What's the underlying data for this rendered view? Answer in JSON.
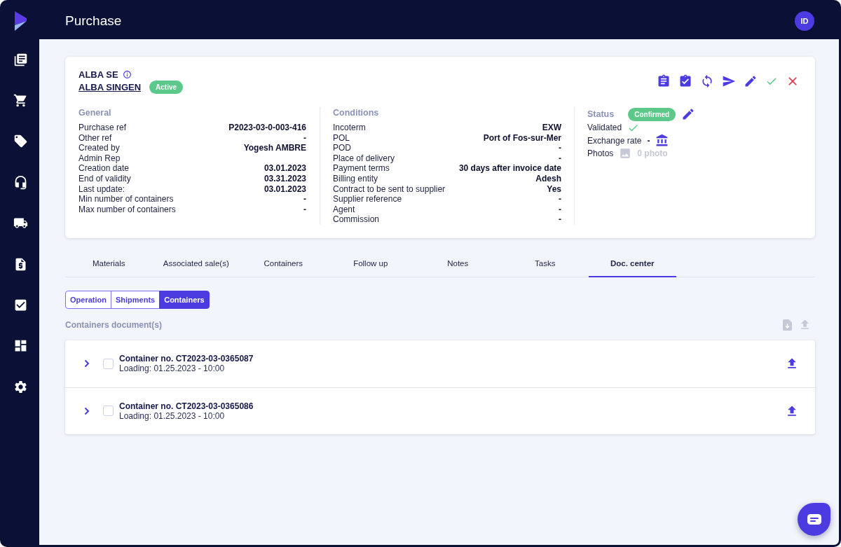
{
  "header": {
    "title": "Purchase",
    "avatar_initials": "ID"
  },
  "supplier": {
    "name": "ALBA SE",
    "site": "ALBA SINGEN",
    "badge": "Active"
  },
  "sections": [
    {
      "title": "General",
      "rows": [
        {
          "label": "Purchase ref",
          "value": "P2023-03-0-003-416"
        },
        {
          "label": "Other ref",
          "value": "-"
        },
        {
          "label": "Created by",
          "value": "Yogesh AMBRE"
        },
        {
          "label": "Admin Rep"
        },
        {
          "label": "Creation date",
          "value": "03.01.2023"
        },
        {
          "label": "End of validity",
          "value": "03.31.2023"
        },
        {
          "label": "Last update:",
          "value": "03.01.2023"
        },
        {
          "label": "Min number of containers",
          "value": "-"
        },
        {
          "label": "Max number of containers",
          "value": "-"
        }
      ]
    },
    {
      "title": "Conditions",
      "rows": [
        {
          "label": "Incoterm",
          "value": "EXW"
        },
        {
          "label": "POL",
          "value": "Port of Fos-sur-Mer"
        },
        {
          "label": "POD",
          "value": "-"
        },
        {
          "label": "Place of delivery",
          "value": "-"
        },
        {
          "label": "Payment terms",
          "value": "30 days after invoice date"
        },
        {
          "label": "Billing entity",
          "value": "Adesh"
        },
        {
          "label": "Contract to be sent to supplier",
          "value": "Yes"
        },
        {
          "label": "Supplier reference",
          "value": "-"
        },
        {
          "label": "Agent",
          "value": "-"
        },
        {
          "label": "Commission",
          "value": "-"
        }
      ]
    }
  ],
  "status_panel": {
    "title": "Status",
    "badge": "Confirmed",
    "validated": {
      "label": "Validated",
      "checked": true
    },
    "exchange_rate": {
      "label": "Exchange rate",
      "value": "-"
    },
    "photos": {
      "label": "Photos",
      "count": "0 photo",
      "disabled": true
    }
  },
  "tabs": [
    {
      "label": "Materials",
      "selected": false
    },
    {
      "label": "Associated sale(s)",
      "selected": false
    },
    {
      "label": "Containers",
      "selected": false
    },
    {
      "label": "Follow up",
      "selected": false
    },
    {
      "label": "Notes",
      "selected": false
    },
    {
      "label": "Tasks",
      "selected": false
    },
    {
      "label": "Doc. center",
      "selected": true
    }
  ],
  "doc_filters": [
    {
      "label": "Operation",
      "selected": false
    },
    {
      "label": "Shipments",
      "selected": false
    },
    {
      "label": "Containers",
      "selected": true
    }
  ],
  "documents": {
    "title": "Containers document(s)",
    "download_disabled": true,
    "upload_disabled": true,
    "rows": [
      {
        "title": "Container no. CT2023-03-0365087",
        "subtitle": "Loading: 01.25.2023 - 10:00",
        "checked": false,
        "expanded": false
      },
      {
        "title": "Container no. CT2023-03-0365086",
        "subtitle": "Loading: 01.25.2023 - 10:00",
        "checked": false,
        "expanded": false
      }
    ]
  }
}
